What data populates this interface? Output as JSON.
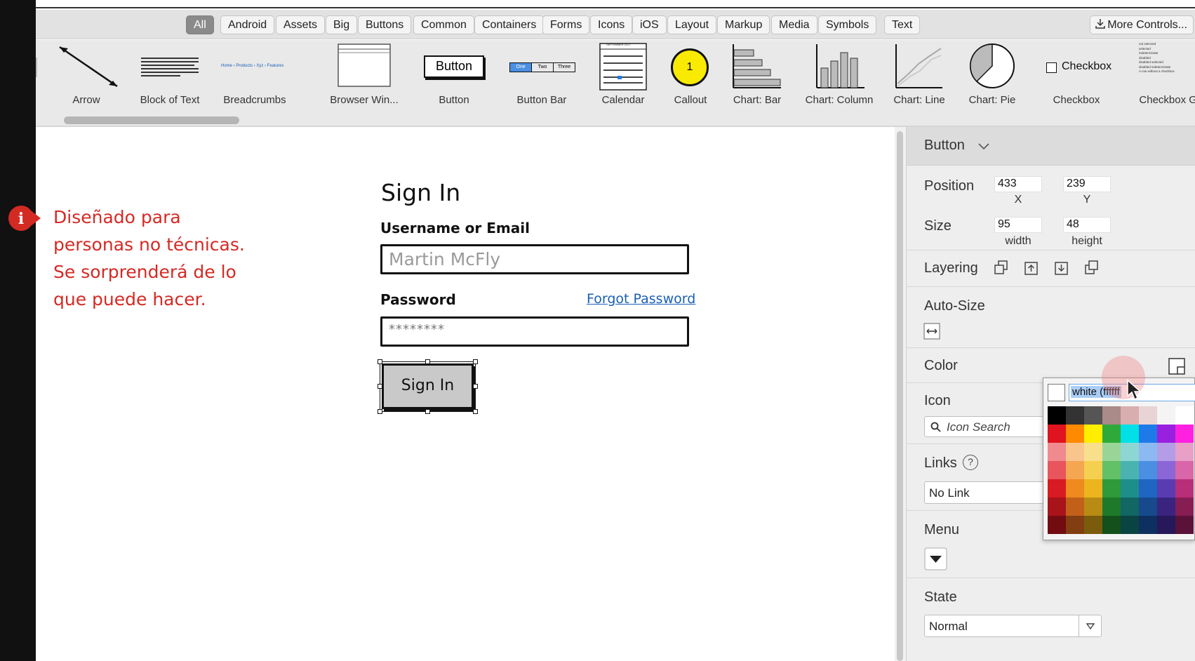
{
  "filters": [
    "All",
    "Android",
    "Assets",
    "Big",
    "Buttons",
    "Common",
    "Containers",
    "Forms",
    "Icons",
    "iOS",
    "Layout",
    "Markup",
    "Media",
    "Symbols",
    "Text"
  ],
  "more_controls": "More Controls...",
  "palette": {
    "arrow": "Arrow",
    "block_of_text": "Block of Text",
    "breadcrumbs": "Breadcrumbs",
    "browser_window": "Browser Win...",
    "button": "Button",
    "button_bar": "Button Bar",
    "calendar": "Calendar",
    "callout": "Callout",
    "chart_bar": "Chart: Bar",
    "chart_column": "Chart: Column",
    "chart_line": "Chart: Line",
    "chart_pie": "Chart: Pie",
    "checkbox": "Checkbox",
    "checkbox_group": "Checkbox Gr...",
    "thumb_button_text": "Button",
    "thumb_checkbox_text": "Checkbox",
    "thumb_callout_number": "1",
    "thumb_buttonbar": [
      "One",
      "Two",
      "Three"
    ],
    "thumb_calendar_title": "SEPTEMBER 2017",
    "thumb_breadcrumbs": "Home › Products › Xyz › Features",
    "thumb_checkbox_group": [
      "not selected",
      "selected",
      "indeterminate",
      "disabled",
      "disabled selected",
      "disabled indeterminate",
      "A row without a checkbox"
    ]
  },
  "note": {
    "lines": [
      "Diseñado para",
      "personas no técnicas.",
      "Se sorprenderá de lo",
      "que puede hacer."
    ],
    "color": "#d42a24",
    "icon_glyph": "i"
  },
  "mockup": {
    "title": "Sign In",
    "username_label": "Username or Email",
    "username_value": "Martin McFly",
    "password_label": "Password",
    "forgot_link": "Forgot Password",
    "password_value": "********",
    "signin_button": "Sign In"
  },
  "inspector": {
    "title": "Button",
    "position_label": "Position",
    "position_x": "433",
    "position_y": "239",
    "x_caption": "X",
    "y_caption": "Y",
    "size_label": "Size",
    "width": "95",
    "height": "48",
    "width_caption": "width",
    "height_caption": "height",
    "layering_label": "Layering",
    "autosize_label": "Auto-Size",
    "color_label": "Color",
    "icon_label": "Icon",
    "icon_search_placeholder": "Icon Search",
    "links_label": "Links",
    "links_help": "?",
    "links_value": "No Link",
    "menu_label": "Menu",
    "state_label": "State",
    "state_value": "Normal"
  },
  "color_picker": {
    "value": "white (ffffff",
    "rows": [
      [
        "#000000",
        "#333333",
        "#555555",
        "#ab8a8a",
        "#d9aeae",
        "#e8d4d4",
        "#f4f4f4",
        "#ffffff"
      ],
      [
        "#e0141e",
        "#ff8a00",
        "#ffee00",
        "#2eaa3a",
        "#00e0e6",
        "#1e7ae8",
        "#9a20e0",
        "#ff20e0"
      ],
      [
        "#f08a8f",
        "#f8c58c",
        "#f8df8c",
        "#9ad598",
        "#8ed6d3",
        "#8cb9f2",
        "#b49de6",
        "#e8a0c6"
      ],
      [
        "#e8555c",
        "#f5a650",
        "#f5cf50",
        "#62c066",
        "#4ab3b0",
        "#4a8fe2",
        "#8a66d6",
        "#d866a8"
      ],
      [
        "#d81a22",
        "#ee8a1e",
        "#ecb41e",
        "#2e9a3a",
        "#1e8e8a",
        "#1e66c2",
        "#5a3cb2",
        "#b82e78"
      ],
      [
        "#a8141a",
        "#c2601a",
        "#b88c14",
        "#1e7a2a",
        "#126664",
        "#164a8c",
        "#3a2480",
        "#861e54"
      ],
      [
        "#720c10",
        "#823e10",
        "#7a5c0c",
        "#14501c",
        "#0a4442",
        "#0e3060",
        "#26185a",
        "#5a1238"
      ]
    ]
  }
}
